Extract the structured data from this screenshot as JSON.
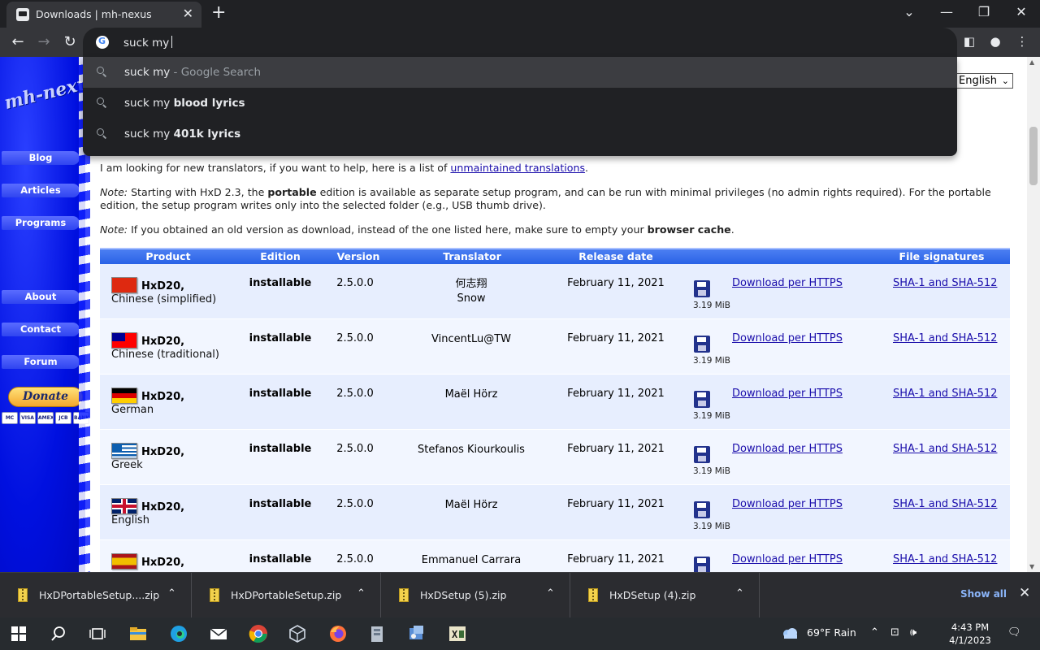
{
  "browser": {
    "tab_title": "Downloads | mh-nexus",
    "tab_close": "✕",
    "new_tab": "+",
    "omnibox_text": "suck my",
    "window_controls": {
      "tabsearch": "⌄",
      "minimize": "—",
      "restore": "❐",
      "close": "✕"
    },
    "nav": {
      "back": "←",
      "forward": "→",
      "reload": "↻"
    },
    "toolbar_right": {
      "sidepanel": "◧",
      "profile": "●",
      "menu": "⋮"
    }
  },
  "suggestions": [
    {
      "normal": "suck my",
      "bold": "",
      "gray": " - Google Search"
    },
    {
      "normal": "suck my ",
      "bold": "blood lyrics",
      "gray": ""
    },
    {
      "normal": "suck my ",
      "bold": "401k lyrics",
      "gray": ""
    }
  ],
  "sidebar": {
    "logo": "mh-nexus",
    "items": [
      {
        "label": "Blog"
      },
      {
        "label": "Articles"
      },
      {
        "label": "Programs"
      },
      {
        "label": "About"
      },
      {
        "label": "Contact"
      },
      {
        "label": "Forum"
      }
    ],
    "donate": "Donate",
    "cards": [
      "MC",
      "VISA",
      "AMEX",
      "JCB",
      "BANK"
    ]
  },
  "language_select": {
    "selected": "English",
    "chevron": "⌄"
  },
  "content": {
    "p1_before": "I am looking for new translators, if you want to help, here is a list of ",
    "p1_link": "unmaintained translations",
    "p1_after": ".",
    "p2_note": "Note:",
    "p2_before": " Starting with HxD 2.3, the ",
    "p2_bold": "portable",
    "p2_after": " edition is available as separate setup program, and can be run with minimal privileges (no admin rights required). For the portable edition, the setup program writes only into the selected folder (e.g., USB thumb drive).",
    "p3_note": "Note:",
    "p3_before": " If you obtained an old version as download, instead of the one listed here, make sure to empty your ",
    "p3_bold": "browser cache",
    "p3_after": "."
  },
  "table": {
    "headers": {
      "product": "Product",
      "edition": "Edition",
      "version": "Version",
      "translator": "Translator",
      "release_date": "Release date",
      "file_signatures": "File signatures"
    },
    "rows": [
      {
        "product": "HxD20,",
        "language": "Chinese (simplified)",
        "edition": "installable",
        "version": "2.5.0.0",
        "translator": "何志翔",
        "translator2": "Snow",
        "release_date": "February 11, 2021",
        "size": "3.19 MiB",
        "download": "Download per HTTPS",
        "signature": "SHA-1 and SHA-512",
        "flag": "china"
      },
      {
        "product": "HxD20,",
        "language": "Chinese (traditional)",
        "edition": "installable",
        "version": "2.5.0.0",
        "translator": "VincentLu@TW",
        "translator2": "",
        "release_date": "February 11, 2021",
        "size": "3.19 MiB",
        "download": "Download per HTTPS",
        "signature": "SHA-1 and SHA-512",
        "flag": "taiwan"
      },
      {
        "product": "HxD20,",
        "language": "German",
        "edition": "installable",
        "version": "2.5.0.0",
        "translator": "Maël Hörz",
        "translator2": "",
        "release_date": "February 11, 2021",
        "size": "3.19 MiB",
        "download": "Download per HTTPS",
        "signature": "SHA-1 and SHA-512",
        "flag": "germany"
      },
      {
        "product": "HxD20,",
        "language": "Greek",
        "edition": "installable",
        "version": "2.5.0.0",
        "translator": "Stefanos Kiourkoulis",
        "translator2": "",
        "release_date": "February 11, 2021",
        "size": "3.19 MiB",
        "download": "Download per HTTPS",
        "signature": "SHA-1 and SHA-512",
        "flag": "greece"
      },
      {
        "product": "HxD20,",
        "language": "English",
        "edition": "installable",
        "version": "2.5.0.0",
        "translator": "Maël Hörz",
        "translator2": "",
        "release_date": "February 11, 2021",
        "size": "3.19 MiB",
        "download": "Download per HTTPS",
        "signature": "SHA-1 and SHA-512",
        "flag": "uk"
      },
      {
        "product": "HxD20,",
        "language": "",
        "edition": "installable",
        "version": "2.5.0.0",
        "translator": "Emmanuel Carrara",
        "translator2": "",
        "release_date": "February 11, 2021",
        "size": "",
        "download": "Download per HTTPS",
        "signature": "SHA-1 and SHA-512",
        "flag": "spain"
      }
    ]
  },
  "scrollbar": {
    "up": "▲",
    "down": "▼"
  },
  "downloads_bar": {
    "items": [
      {
        "name": "HxDPortableSetup....zip"
      },
      {
        "name": "HxDPortableSetup.zip"
      },
      {
        "name": "HxDSetup (5).zip"
      },
      {
        "name": "HxDSetup (4).zip"
      }
    ],
    "chevron": "⌃",
    "show_all": "Show all",
    "close": "✕"
  },
  "taskbar": {
    "weather": "69°F  Rain",
    "time": "4:43 PM",
    "date": "4/1/2023",
    "tray": {
      "chevron": "⌃",
      "network": "⊡",
      "volume": "🕪",
      "notifications": "🗨"
    }
  },
  "colors": {
    "chrome_dark": "#202124",
    "chrome_toolbar": "#35363a",
    "sidebar_blue": "#0010e0",
    "table_header": "#2962e6",
    "link": "#1a0dab"
  }
}
